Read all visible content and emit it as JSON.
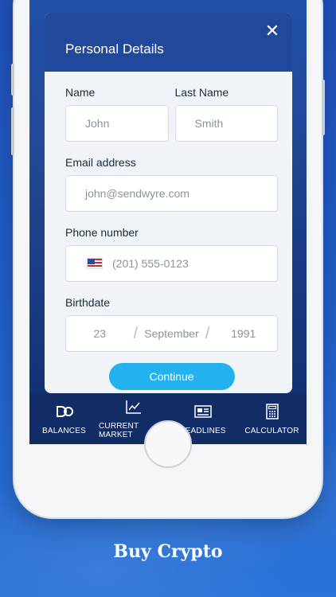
{
  "modal": {
    "title": "Personal Details",
    "close_icon": "close-icon"
  },
  "form": {
    "name_label": "Name",
    "name_value": "John",
    "last_name_label": "Last Name",
    "last_name_value": "Smith",
    "email_label": "Email address",
    "email_value": "john@sendwyre.com",
    "phone_label": "Phone number",
    "phone_flag": "us-flag-icon",
    "phone_value": "(201) 555-0123",
    "birthdate_label": "Birthdate",
    "birth_day": "23",
    "birth_month": "September",
    "birth_year": "1991",
    "date_separator": "/"
  },
  "continue_label": "Continue",
  "tabs": [
    {
      "label": "BALANCES",
      "icon": "balances-icon"
    },
    {
      "label": "CURRENT MARKET",
      "icon": "chart-icon"
    },
    {
      "label": "HEADLINES",
      "icon": "newspaper-icon"
    },
    {
      "label": "CALCULATOR",
      "icon": "calculator-icon"
    }
  ],
  "caption": "Buy Crypto",
  "colors": {
    "background": "#2160c8",
    "modal_header": "#21489b",
    "tabbar": "#122c66",
    "accent_button": "#23b1ef"
  }
}
